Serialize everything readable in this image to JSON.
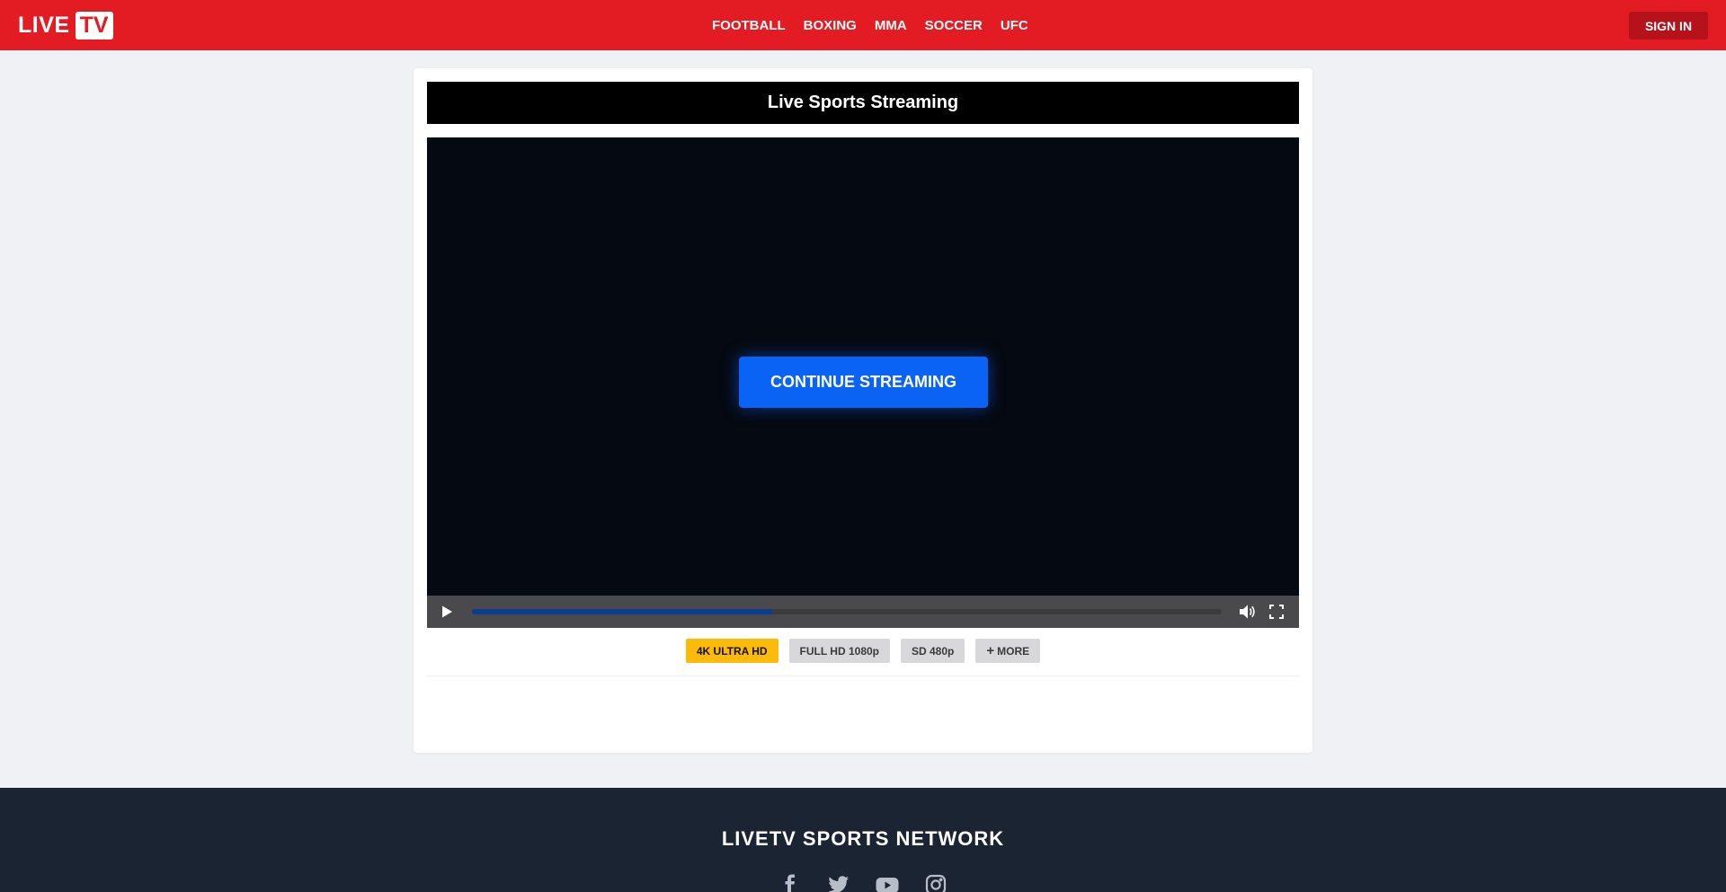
{
  "header": {
    "logo_live": "LIVE",
    "logo_tv": "TV",
    "nav": [
      "FOOTBALL",
      "BOXING",
      "MMA",
      "SOCCER",
      "UFC"
    ],
    "signin_label": "SIGN IN",
    "brand_color": "#e31b23"
  },
  "main": {
    "title": "Live Sports Streaming",
    "player": {
      "cta_label": "CONTINUE STREAMING",
      "progress_fraction": 0.4,
      "icons": [
        "play-icon",
        "volume-icon",
        "fullscreen-icon"
      ]
    },
    "quality_options": [
      {
        "label": "4K ULTRA HD",
        "active": true
      },
      {
        "label": "FULL HD 1080p",
        "active": false
      },
      {
        "label": "SD 480p",
        "active": false
      },
      {
        "label": "MORE",
        "active": false,
        "icon": "plus-icon"
      }
    ]
  },
  "footer": {
    "title": "LIVETV SPORTS NETWORK",
    "socials": [
      "facebook-icon",
      "twitter-icon",
      "youtube-icon",
      "instagram-icon"
    ]
  }
}
